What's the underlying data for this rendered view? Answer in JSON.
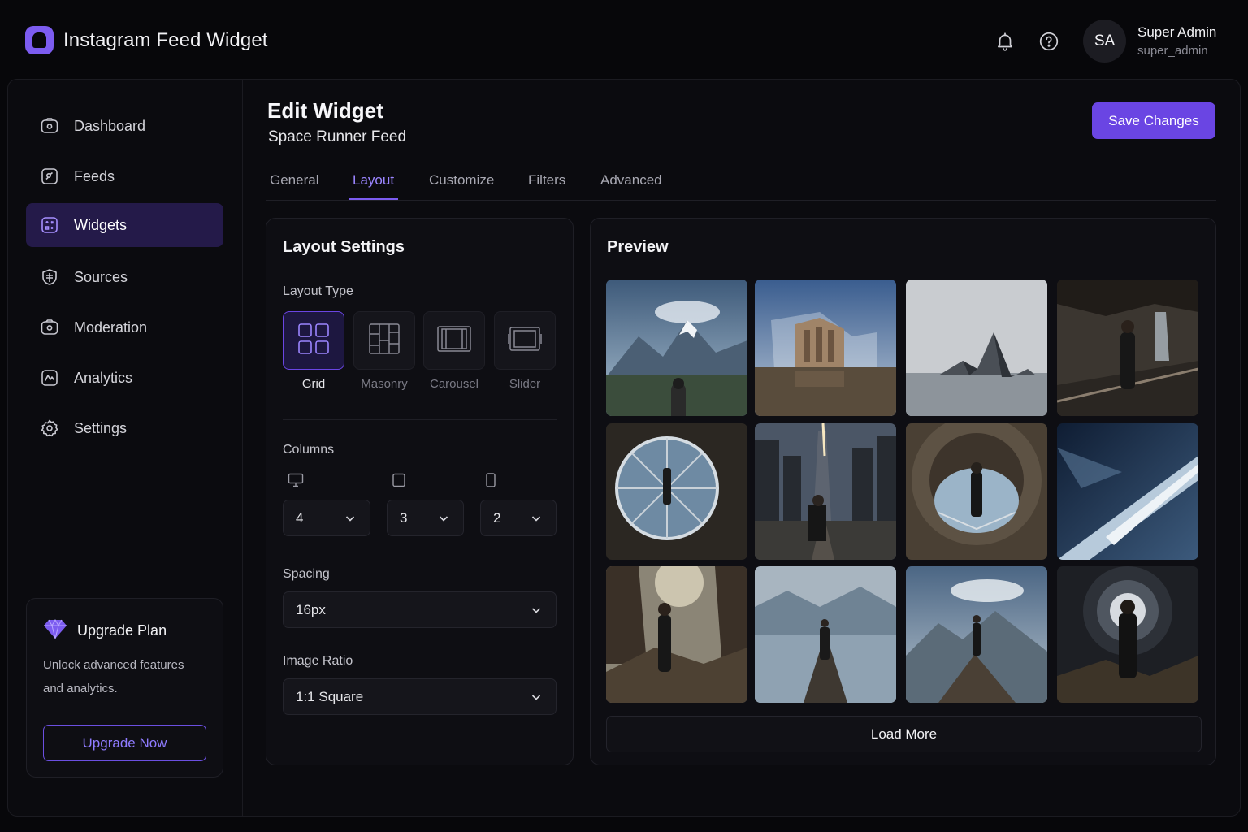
{
  "app": {
    "title": "Instagram Feed Widget",
    "brand_color": "#7c5cf0"
  },
  "header": {
    "notifications_icon": "bell-icon",
    "help_icon": "question-circle-icon",
    "user": {
      "initials": "SA",
      "name": "Super Admin",
      "handle": "super_admin"
    }
  },
  "sidebar": {
    "items": [
      {
        "label": "Dashboard",
        "icon": "dashboard-icon",
        "active": false
      },
      {
        "label": "Feeds",
        "icon": "feeds-icon",
        "active": false
      },
      {
        "label": "Widgets",
        "icon": "widgets-icon",
        "active": true
      },
      {
        "label": "Sources",
        "icon": "sources-icon",
        "active": false
      },
      {
        "label": "Moderation",
        "icon": "moderation-icon",
        "active": false
      },
      {
        "label": "Analytics",
        "icon": "analytics-icon",
        "active": false
      },
      {
        "label": "Settings",
        "icon": "gear-icon",
        "active": false
      }
    ],
    "upgrade": {
      "title": "Upgrade Plan",
      "icon": "diamond-icon",
      "description": "Unlock advanced features and analytics.",
      "button_label": "Upgrade Now"
    }
  },
  "main": {
    "title": "Edit Widget",
    "subtitle": "Space Runner Feed",
    "save_label": "Save Changes",
    "tabs": [
      {
        "label": "General",
        "active": false
      },
      {
        "label": "Layout",
        "active": true
      },
      {
        "label": "Customize",
        "active": false
      },
      {
        "label": "Filters",
        "active": false
      },
      {
        "label": "Advanced",
        "active": false
      }
    ],
    "accent_color": "#6a45e3"
  },
  "layout_settings": {
    "title": "Layout Settings",
    "layout_type_label": "Layout Type",
    "layout_types": [
      {
        "label": "Grid",
        "icon": "grid-layout-icon",
        "selected": true
      },
      {
        "label": "Masonry",
        "icon": "masonry-layout-icon",
        "selected": false
      },
      {
        "label": "Carousel",
        "icon": "carousel-layout-icon",
        "selected": false
      },
      {
        "label": "Slider",
        "icon": "slider-layout-icon",
        "selected": false
      }
    ],
    "columns_label": "Columns",
    "columns": {
      "desktop": {
        "icon": "desktop-icon",
        "value": "4"
      },
      "tablet": {
        "icon": "tablet-icon",
        "value": "3"
      },
      "mobile": {
        "icon": "mobile-icon",
        "value": "2"
      }
    },
    "spacing_label": "Spacing",
    "spacing_value": "16px",
    "image_ratio_label": "Image Ratio",
    "image_ratio_value": "1:1 Square"
  },
  "preview": {
    "title": "Preview",
    "load_more_label": "Load More",
    "images": [
      "hiker-mountain-lake",
      "brutalist-building-water",
      "pyramid-peaks-sea",
      "man-cave-waterfall",
      "glass-sphere-figure",
      "city-street-figure",
      "tunnel-portal-figure",
      "blue-ice-ridge",
      "man-rocky-canyon",
      "man-pier-lake",
      "man-mountain-peak",
      "man-dark-portal"
    ]
  }
}
